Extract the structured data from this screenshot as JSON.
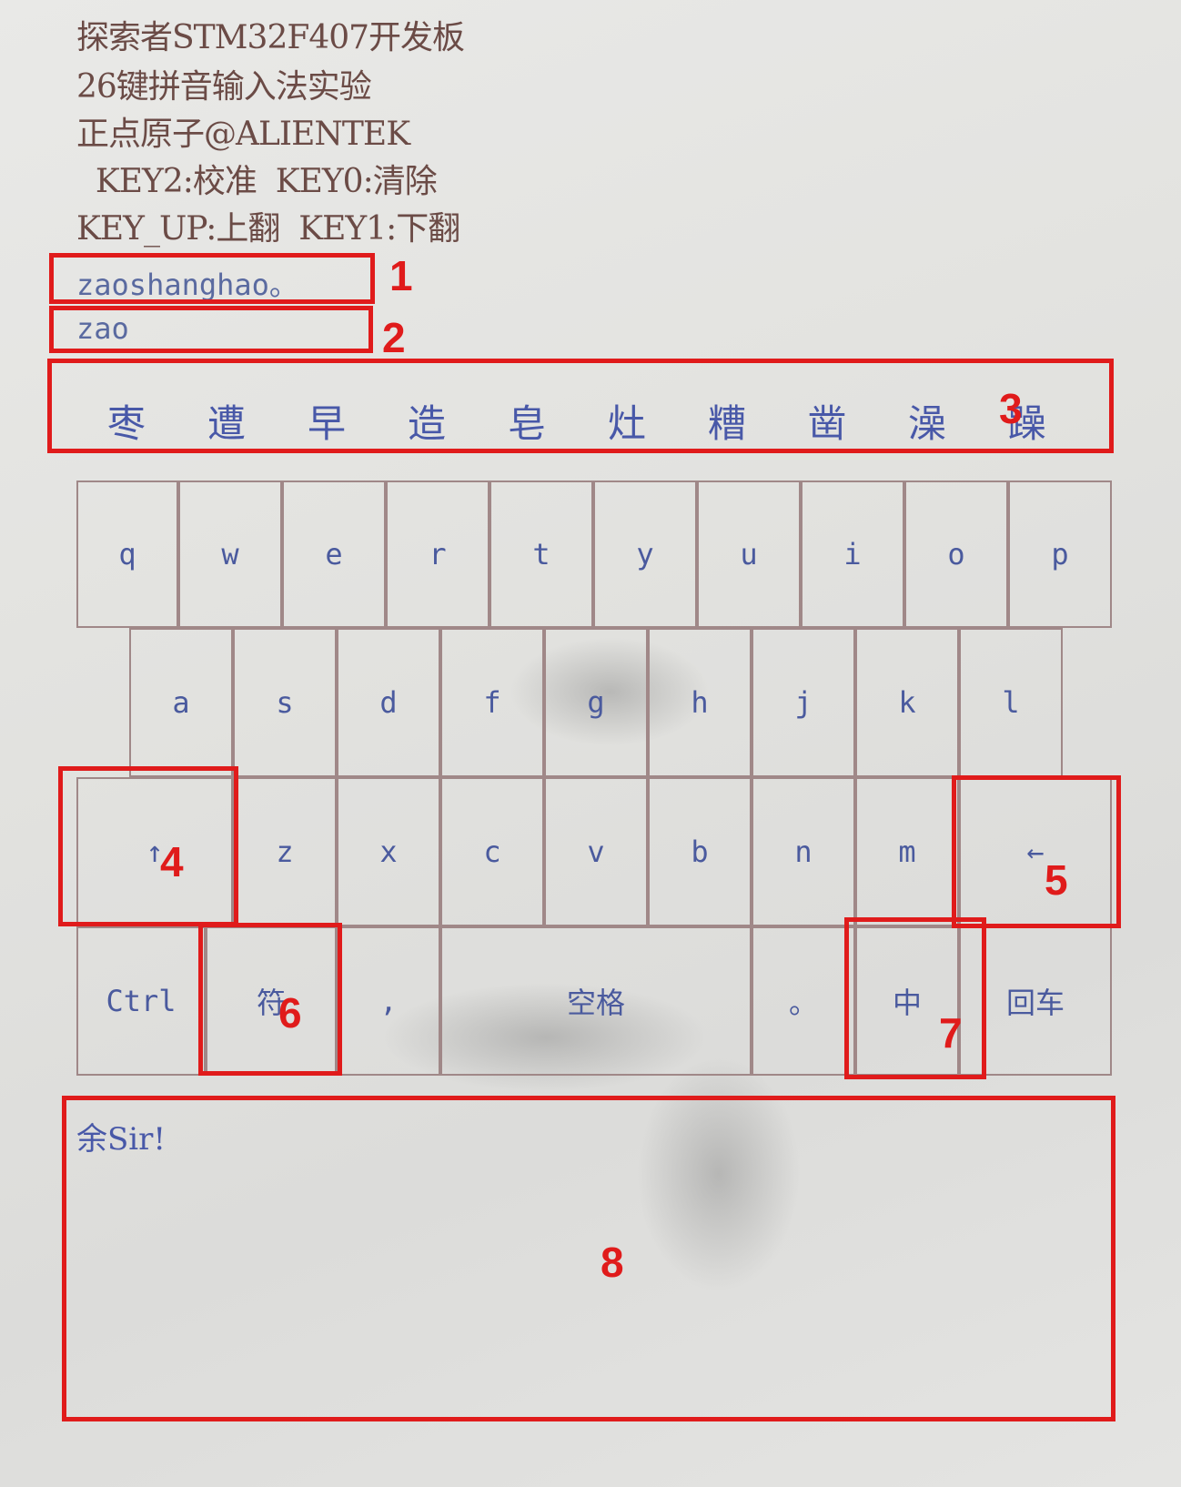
{
  "header": {
    "line1": "探索者STM32F407开发板",
    "line2": "26键拼音输入法实验",
    "line3": "正点原子@ALIENTEK",
    "line4": "  KEY2:校准  KEY0:清除",
    "line5": "KEY_UP:上翻  KEY1:下翻"
  },
  "input": {
    "pinyin_string": "zaoshanghao。",
    "current_pinyin": "zao"
  },
  "candidates": [
    "枣",
    "遭",
    "早",
    "造",
    "皂",
    "灶",
    "糟",
    "凿",
    "澡",
    "躁"
  ],
  "keyboard": {
    "row1": [
      "q",
      "w",
      "e",
      "r",
      "t",
      "y",
      "u",
      "i",
      "o",
      "p"
    ],
    "row2": [
      "a",
      "s",
      "d",
      "f",
      "g",
      "h",
      "j",
      "k",
      "l"
    ],
    "row3": {
      "shift": "↑",
      "letters": [
        "z",
        "x",
        "c",
        "v",
        "b",
        "n",
        "m"
      ],
      "backspace": "←"
    },
    "row4": {
      "ctrl": "Ctrl",
      "symbol": "符",
      "comma": ",",
      "space": "空格",
      "period": "。",
      "lang": "中",
      "enter": "回车"
    }
  },
  "output": {
    "text": "余Sir!"
  },
  "annotations": [
    "1",
    "2",
    "3",
    "4",
    "5",
    "6",
    "7",
    "8"
  ],
  "colors": {
    "annotation": "#e01b1b",
    "key_border": "#a08888",
    "key_text": "#4a5a9e",
    "header_text": "#6b4b46"
  }
}
